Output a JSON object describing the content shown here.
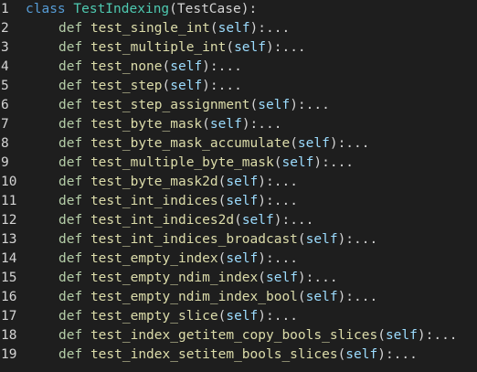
{
  "editor": {
    "colors": {
      "background": "#1e1e1e",
      "keyword": "#569cd6",
      "class_name": "#4ec9b0",
      "function_name": "#dcdcaa",
      "parameter": "#9cdcfe",
      "def_keyword": "#b5cea8",
      "text": "#d4d4d4"
    },
    "header": {
      "number": "1",
      "keyword": "class",
      "class_name": "TestIndexing",
      "base": "(TestCase):"
    },
    "lines": [
      {
        "number": "2",
        "keyword": "def",
        "name": "test_single_int",
        "param": "self",
        "tail": "):..."
      },
      {
        "number": "3",
        "keyword": "def",
        "name": "test_multiple_int",
        "param": "self",
        "tail": "):..."
      },
      {
        "number": "4",
        "keyword": "def",
        "name": "test_none",
        "param": "self",
        "tail": "):..."
      },
      {
        "number": "5",
        "keyword": "def",
        "name": "test_step",
        "param": "self",
        "tail": "):..."
      },
      {
        "number": "6",
        "keyword": "def",
        "name": "test_step_assignment",
        "param": "self",
        "tail": "):..."
      },
      {
        "number": "7",
        "keyword": "def",
        "name": "test_byte_mask",
        "param": "self",
        "tail": "):..."
      },
      {
        "number": "8",
        "keyword": "def",
        "name": "test_byte_mask_accumulate",
        "param": "self",
        "tail": "):..."
      },
      {
        "number": "9",
        "keyword": "def",
        "name": "test_multiple_byte_mask",
        "param": "self",
        "tail": "):..."
      },
      {
        "number": "10",
        "keyword": "def",
        "name": "test_byte_mask2d",
        "param": "self",
        "tail": "):..."
      },
      {
        "number": "11",
        "keyword": "def",
        "name": "test_int_indices",
        "param": "self",
        "tail": "):..."
      },
      {
        "number": "12",
        "keyword": "def",
        "name": "test_int_indices2d",
        "param": "self",
        "tail": "):..."
      },
      {
        "number": "13",
        "keyword": "def",
        "name": "test_int_indices_broadcast",
        "param": "self",
        "tail": "):..."
      },
      {
        "number": "14",
        "keyword": "def",
        "name": "test_empty_index",
        "param": "self",
        "tail": "):..."
      },
      {
        "number": "15",
        "keyword": "def",
        "name": "test_empty_ndim_index",
        "param": "self",
        "tail": "):..."
      },
      {
        "number": "16",
        "keyword": "def",
        "name": "test_empty_ndim_index_bool",
        "param": "self",
        "tail": "):..."
      },
      {
        "number": "17",
        "keyword": "def",
        "name": "test_empty_slice",
        "param": "self",
        "tail": "):..."
      },
      {
        "number": "18",
        "keyword": "def",
        "name": "test_index_getitem_copy_bools_slices",
        "param": "self",
        "tail": "):..."
      },
      {
        "number": "19",
        "keyword": "def",
        "name": "test_index_setitem_bools_slices",
        "param": "self",
        "tail": "):..."
      }
    ]
  }
}
